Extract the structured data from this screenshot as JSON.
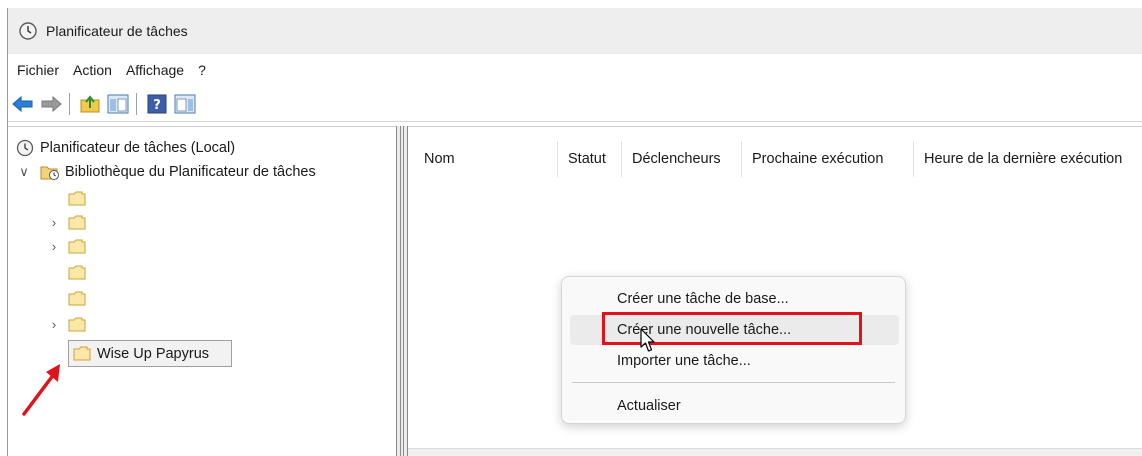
{
  "window": {
    "title": "Planificateur de tâches",
    "icon": "clock-icon"
  },
  "menubar": {
    "items": [
      "Fichier",
      "Action",
      "Affichage",
      "?"
    ]
  },
  "toolbar": {
    "buttons": [
      "back-arrow-icon",
      "forward-arrow-icon",
      "up-folder-icon",
      "show-hide-tree-icon",
      "help-icon",
      "action-pane-icon"
    ]
  },
  "tree": {
    "root": "Planificateur de tâches (Local)",
    "library": "Bibliothèque du Planificateur de tâches",
    "chevron_expanded": "∨",
    "chevron_collapsed": "›",
    "selected_folder": "Wise Up Papyrus"
  },
  "table": {
    "columns": [
      "Nom",
      "Statut",
      "Déclencheurs",
      "Prochaine exécution",
      "Heure de la dernière exécution"
    ]
  },
  "context_menu": {
    "items": [
      "Créer une tâche de base...",
      "Créer une nouvelle tâche...",
      "Importer une tâche...",
      "Actualiser"
    ],
    "highlighted_index": 1
  },
  "colors": {
    "annotation_red": "#e0121b",
    "accent_blue": "#1e73d8"
  }
}
